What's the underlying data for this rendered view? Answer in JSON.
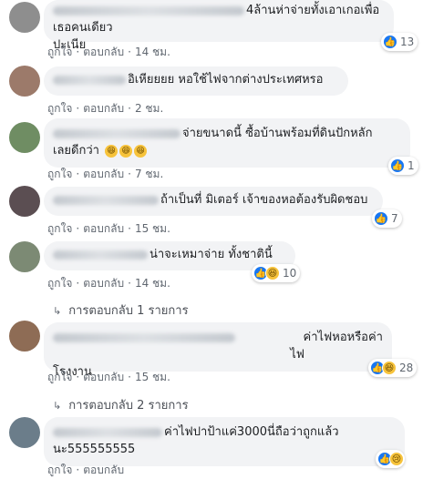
{
  "actions": {
    "like": "ถูกใจ",
    "reply": "ตอบกลับ",
    "dot": "·"
  },
  "comments": [
    {
      "name": "Wuttinan Thanagarn",
      "text1": "4ล้านห่าจ่ายทั้งเอาเกอเพื่อเธอคนเดียว",
      "text2": "ปะเนีย",
      "time": "14 ชม.",
      "reactions": [
        "like"
      ],
      "count": "13"
    },
    {
      "name": "Ungkan Saikan",
      "text1": "อิเหียยยย หอใช้ไฟจากต่างประเทศหรอ",
      "time": "2 ชม."
    },
    {
      "name": "Jeraporn Jeravanit",
      "text1": "จ่ายขนาดนี้ ซื้อบ้านพร้อมที่ดินปักหลัก",
      "text2": "เลยดีกว่า",
      "emojis": [
        "😆",
        "😆",
        "😆"
      ],
      "time": "7 ชม.",
      "reactions": [
        "like"
      ],
      "count": "1"
    },
    {
      "name": "Jaruwat Jaipanya",
      "text1": "ถ้าเป็นที่ มิเตอร์ เจ้าของหอต้องรับผิดชอบ",
      "time": "15 ชม.",
      "reactions": [
        "like"
      ],
      "count": "7"
    },
    {
      "name": "Kongpob Rokan",
      "text1": "น่าจะเหมาจ่าย ทั้งชาตินี้",
      "time": "14 ชม.",
      "reactions": [
        "like",
        "haha"
      ],
      "count": "10",
      "replies": "การตอบกลับ 1 รายการ"
    },
    {
      "name": "Jintana Naovarat",
      "text1": "ค่าไฟหอหรือค่าไฟ",
      "text2": "โรงงาน",
      "time": "15 ชม.",
      "reactions": [
        "like",
        "haha"
      ],
      "count": "28",
      "replies": "การตอบกลับ 2 รายการ"
    },
    {
      "name": "Sarinan Wangsang",
      "text1": "ค่าไฟปาป้าแค่3000นี่ถือว่าถูกแล้ว",
      "text2": "นะ555555555",
      "reactions": [
        "like",
        "sad"
      ]
    }
  ]
}
